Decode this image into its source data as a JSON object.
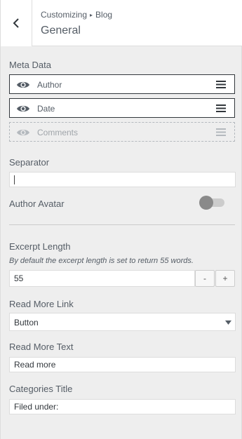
{
  "header": {
    "breadcrumb_root": "Customizing",
    "breadcrumb_sep_icon": "triangle-right-icon",
    "breadcrumb_child": "Blog",
    "title": "General"
  },
  "meta_data": {
    "label": "Meta Data",
    "items": [
      {
        "label": "Author",
        "visible": true
      },
      {
        "label": "Date",
        "visible": true
      },
      {
        "label": "Comments",
        "visible": false
      }
    ]
  },
  "separator": {
    "label": "Separator",
    "value": ""
  },
  "author_avatar": {
    "label": "Author Avatar",
    "enabled": false
  },
  "excerpt": {
    "label": "Excerpt Length",
    "description": "By default the excerpt length is set to return 55 words.",
    "value": "55",
    "minus": "-",
    "plus": "+"
  },
  "read_more_link": {
    "label": "Read More Link",
    "selected": "Button"
  },
  "read_more_text": {
    "label": "Read More Text",
    "value": "Read more"
  },
  "categories_title": {
    "label": "Categories Title",
    "value": "Filed under:"
  },
  "colors": {
    "border_active": "#32373c",
    "toggle_knob": "#8a8a8a",
    "toggle_track": "#cccccc"
  }
}
